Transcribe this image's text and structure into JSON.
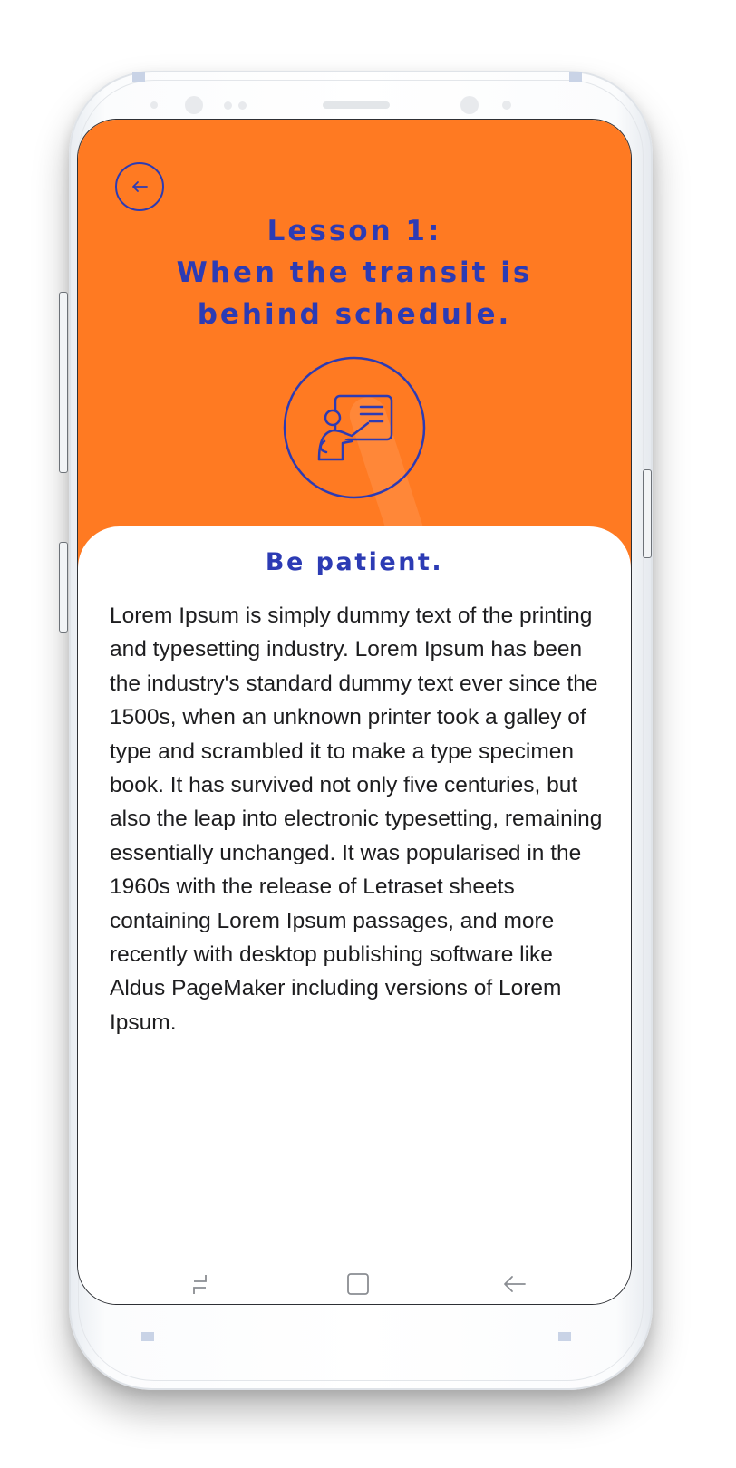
{
  "colors": {
    "hero_background": "#ff7a22",
    "accent": "#2c3bb4",
    "body_text": "#1d1d1f",
    "card_background": "#ffffff"
  },
  "header": {
    "back_icon": "arrow-left-icon",
    "title_lines": [
      "Lesson 1:",
      "When the transit is",
      "behind schedule."
    ],
    "illustration_icon": "teacher-at-board-icon"
  },
  "content": {
    "heading": "Be patient.",
    "body": "Lorem Ipsum is simply dummy text of the printing and typesetting industry. Lorem Ipsum has been the industry's standard dummy text ever since the 1500s, when an unknown printer took a galley of type and scrambled it to make a type specimen book. It has survived not only five centuries, but also the leap into electronic typesetting, remaining essentially unchanged. It was popularised in the 1960s with the release of Letraset sheets containing Lorem Ipsum passages, and more recently with desktop publishing software like Aldus PageMaker including versions of Lorem Ipsum."
  },
  "navigation_bar": {
    "icons": [
      "recent-apps-icon",
      "home-icon",
      "back-icon"
    ]
  }
}
